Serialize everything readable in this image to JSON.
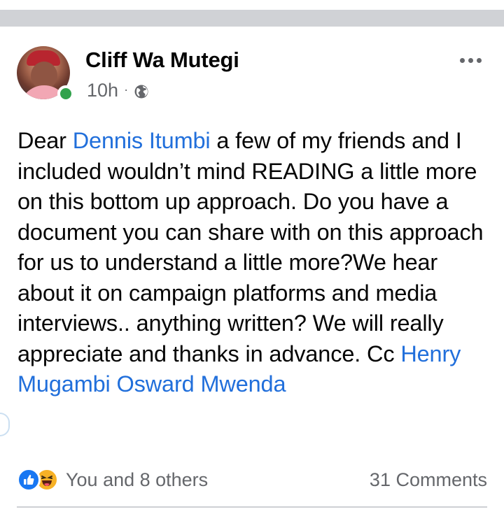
{
  "post": {
    "author": "Cliff Wa Mutegi",
    "time": "10h",
    "separator": "·",
    "privacy_icon": "globe-icon",
    "menu_icon": "more-options-icon",
    "body": [
      {
        "text": "Dear ",
        "type": "text"
      },
      {
        "text": "Dennis Itumbi",
        "type": "mention"
      },
      {
        "text": " a few of my friends and I included wouldn’t mind READING a little more on this bottom up approach. Do you have a document you can share with on this approach for us to understand a little more?We hear about it on campaign platforms and media interviews.. anything written? We will really appreciate and thanks in advance. Cc ",
        "type": "text"
      },
      {
        "text": "Henry Mugambi Osward Mwenda",
        "type": "mention"
      }
    ]
  },
  "footer": {
    "reaction_icons": [
      "like-icon",
      "haha-icon"
    ],
    "reactions_text": "You and 8 others",
    "comments_text": "31 Comments"
  },
  "colors": {
    "mention": "#216fdb",
    "secondary_text": "#65676b",
    "online": "#31a24c",
    "like": "#1877f2",
    "haha": "#f7b125"
  }
}
